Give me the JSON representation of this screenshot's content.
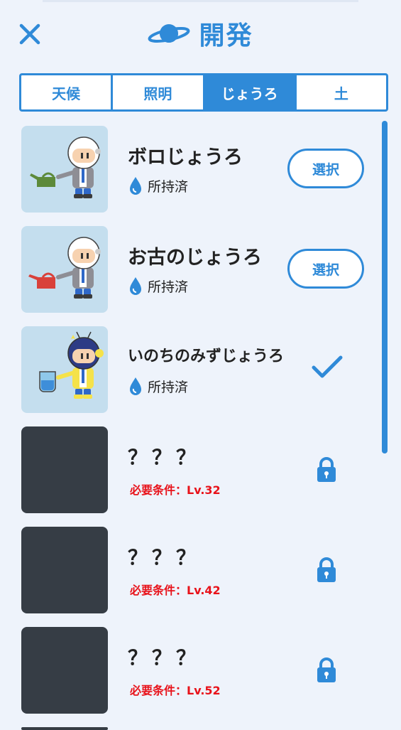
{
  "header": {
    "title": "開発",
    "close_icon": "close-icon",
    "title_icon": "planet-icon"
  },
  "tabs": [
    {
      "label": "天候",
      "active": false
    },
    {
      "label": "照明",
      "active": false
    },
    {
      "label": "じょうろ",
      "active": true
    },
    {
      "label": "土",
      "active": false
    }
  ],
  "items": [
    {
      "name": "ボロじょうろ",
      "status": "所持済",
      "action": "選択",
      "state": "owned"
    },
    {
      "name": "お古のじょうろ",
      "status": "所持済",
      "action": "選択",
      "state": "owned"
    },
    {
      "name": "いのちのみずじょうろ",
      "status": "所持済",
      "state": "selected"
    },
    {
      "name": "？？？",
      "requirement": "必要条件：Lv.32",
      "state": "locked"
    },
    {
      "name": "？？？",
      "requirement": "必要条件：Lv.42",
      "state": "locked"
    },
    {
      "name": "？？？",
      "requirement": "必要条件：Lv.52",
      "state": "locked"
    }
  ],
  "colors": {
    "accent": "#2f8ad8",
    "background": "#eef3fb",
    "requirement": "#e8121a",
    "locked_thumb": "#363d45",
    "thumb_bg": "#c4deee"
  }
}
